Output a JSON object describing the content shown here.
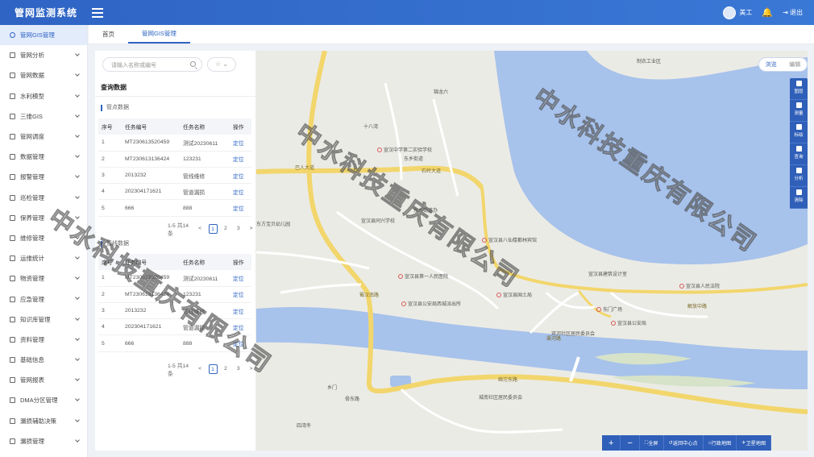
{
  "app": {
    "title": "管网监测系统"
  },
  "header": {
    "user_name": "美工",
    "logout_label": "退出"
  },
  "sidebar": {
    "items": [
      {
        "label": "管网GIS管理",
        "active": true
      },
      {
        "label": "管网分析"
      },
      {
        "label": "管网数据"
      },
      {
        "label": "水利模型"
      },
      {
        "label": "三维GIS"
      },
      {
        "label": "管网调度"
      },
      {
        "label": "数据管理"
      },
      {
        "label": "报警管理"
      },
      {
        "label": "巡检管理"
      },
      {
        "label": "保养管理"
      },
      {
        "label": "维修管理"
      },
      {
        "label": "运维统计"
      },
      {
        "label": "物资管理"
      },
      {
        "label": "应急管理"
      },
      {
        "label": "知识库管理"
      },
      {
        "label": "资料管理"
      },
      {
        "label": "基础信息"
      },
      {
        "label": "管网报表"
      },
      {
        "label": "DMA分区管理"
      },
      {
        "label": "漏损辅助决策"
      },
      {
        "label": "漏损管理"
      }
    ]
  },
  "tabs": [
    {
      "label": "首页"
    },
    {
      "label": "管网GIS管理",
      "active": true
    }
  ],
  "search": {
    "placeholder": "请输入名称或编号",
    "star": "☆ ⌄"
  },
  "panel": {
    "title": "查询数据",
    "section1_title": "管点数据",
    "section2_title": "管线数据",
    "columns": [
      "序号",
      "任务编号",
      "任务名称",
      "操作"
    ],
    "rows": [
      {
        "no": "1",
        "code": "MT230613520459",
        "name": "测试20230611",
        "action": "定位"
      },
      {
        "no": "2",
        "code": "MT230613136424",
        "name": "123231",
        "action": "定位"
      },
      {
        "no": "3",
        "code": "2013232",
        "name": "管线维修",
        "action": "定位"
      },
      {
        "no": "4",
        "code": "202304171621",
        "name": "管道漏损",
        "action": "定位"
      },
      {
        "no": "5",
        "code": "666",
        "name": "888",
        "action": "定位"
      }
    ],
    "pager": {
      "summary": "1-5 共14条",
      "prev": "<",
      "pages": [
        "1",
        "2",
        "3"
      ],
      "next": ">"
    }
  },
  "map": {
    "mode": {
      "browse": "浏览",
      "edit": "编辑"
    },
    "tools": [
      {
        "label": "图层",
        "icon": "layers-icon"
      },
      {
        "label": "测量",
        "icon": "measure-icon"
      },
      {
        "label": "标绘",
        "icon": "plot-icon"
      },
      {
        "label": "查询",
        "icon": "query-icon"
      },
      {
        "label": "分析",
        "icon": "analysis-icon"
      },
      {
        "label": "清除",
        "icon": "clear-icon"
      }
    ],
    "bottom_tools": {
      "zoom_in": "+",
      "zoom_out": "−",
      "fullscreen": "全屏",
      "center": "返回中心点",
      "admin_map": "行政地图",
      "satellite_map": "卫星地图"
    },
    "labels": {
      "l1": "制衣工业区",
      "l2": "锦龙六",
      "l3": "十八湾",
      "l4": "宣汉中学第二实验学校",
      "l5": "东乡街道",
      "l6": "石岭大道",
      "l7": "宣汉县同兴学校",
      "l8": "宣汉县人民医院",
      "l9": "宣汉县八仙楼都林宾馆",
      "l10": "宣汉县建筑设计室",
      "l11": "宣汉县人民法院",
      "l12": "解放中路",
      "l13": "东门广场",
      "l14": "宣汉县公安局",
      "l15": "渠河路",
      "l16": "绵沱东路",
      "l17": "宣汉县公安局西城派出所",
      "l18": "城南社区居民委员会",
      "l19": "四湾冬",
      "l20": "东乡街道办",
      "l21": "巴人大道",
      "l22": "蜀汉南路",
      "l23": "宣汉县第一人民医院",
      "l24": "东方宝贝幼儿园",
      "l25": "宣汉县国土局",
      "l26": "乡门",
      "l27": "骨东路",
      "l28": "双河社区居民委员会"
    },
    "watermark": "中水科技重庆有限公司"
  }
}
